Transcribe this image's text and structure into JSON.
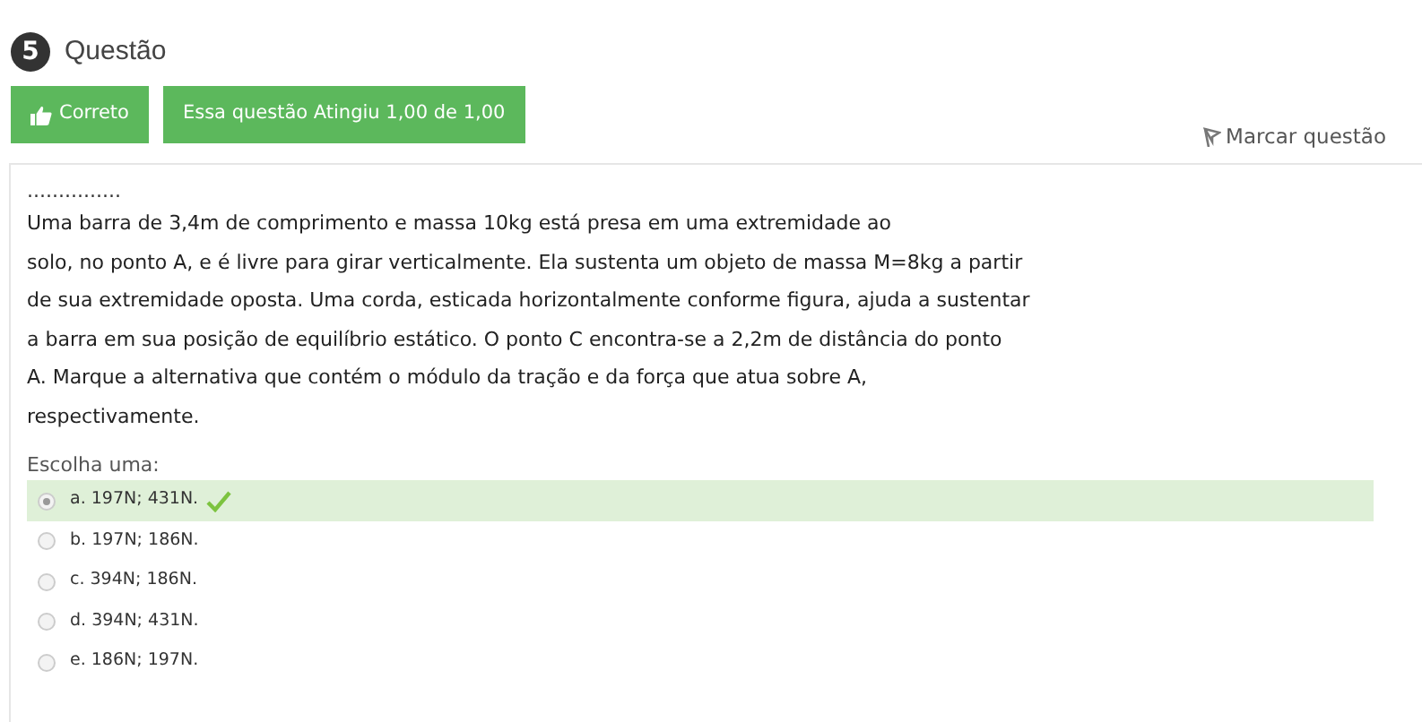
{
  "question": {
    "number": "5",
    "title": "Questão"
  },
  "status_buttons": [
    {
      "kind": "outcome",
      "label": "Correto"
    },
    {
      "kind": "grade",
      "label": "Essa questão Atingiu 1,00 de 1,00"
    }
  ],
  "flag": {
    "label": "Marcar questão"
  },
  "prompt": {
    "dots": "...............",
    "lines": [
      "Uma barra de 3,4m de comprimento e massa 10kg está presa em uma extremidade ao",
      "solo, no ponto A, e é livre para girar verticalmente. Ela sustenta um objeto de massa M=8kg a partir",
      "de sua extremidade oposta. Uma corda, esticada horizontalmente conforme figura, ajuda a sustentar",
      "a barra em sua posição de equilíbrio estático. O ponto C encontra-se a 2,2m de distância do ponto",
      "A. Marque a alternativa que contém o módulo da tração e da força que atua sobre A,",
      "respectivamente."
    ]
  },
  "choice_label": "Escolha uma:",
  "options": [
    {
      "label": "a. 197N; 431N.",
      "selected": true,
      "correct": true
    },
    {
      "label": "b. 197N; 186N.",
      "selected": false,
      "correct": false
    },
    {
      "label": "c. 394N; 186N.",
      "selected": false,
      "correct": false
    },
    {
      "label": "d. 394N; 431N.",
      "selected": false,
      "correct": false
    },
    {
      "label": "e. 186N; 197N.",
      "selected": false,
      "correct": false
    }
  ]
}
